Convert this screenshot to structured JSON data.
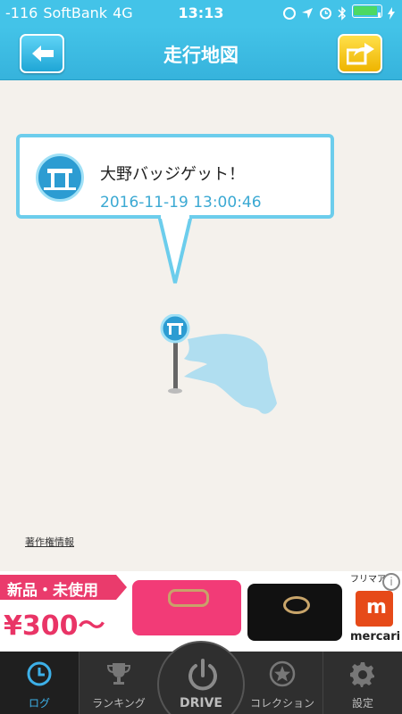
{
  "status_bar": {
    "signal": "-116",
    "carrier": "SoftBank",
    "network": "4G",
    "time": "13:13"
  },
  "header": {
    "title": "走行地図",
    "back_icon": "arrow-left-icon",
    "share_icon": "share-icon"
  },
  "callout": {
    "title": "大野バッジゲット！",
    "timestamp": "2016-11-19 13:00:46"
  },
  "map": {
    "copyright": "著作権情報"
  },
  "ad": {
    "tag": "新品・未使用",
    "price": "¥300〜",
    "brand_top": "フリマアプ",
    "brand": "mercari",
    "info_symbol": "i"
  },
  "tabbar": {
    "tabs": [
      {
        "label": "ログ",
        "icon": "clock-icon",
        "active": true
      },
      {
        "label": "ランキング",
        "icon": "trophy-icon",
        "active": false
      },
      {
        "label": "DRIVE",
        "icon": "power-icon",
        "active": false
      },
      {
        "label": "コレクション",
        "icon": "star-icon",
        "active": false
      },
      {
        "label": "設定",
        "icon": "gear-icon",
        "active": false
      }
    ]
  },
  "colors": {
    "header": "#43c3e8",
    "accent": "#3db0e8",
    "ad_pink": "#ea3b6c"
  }
}
